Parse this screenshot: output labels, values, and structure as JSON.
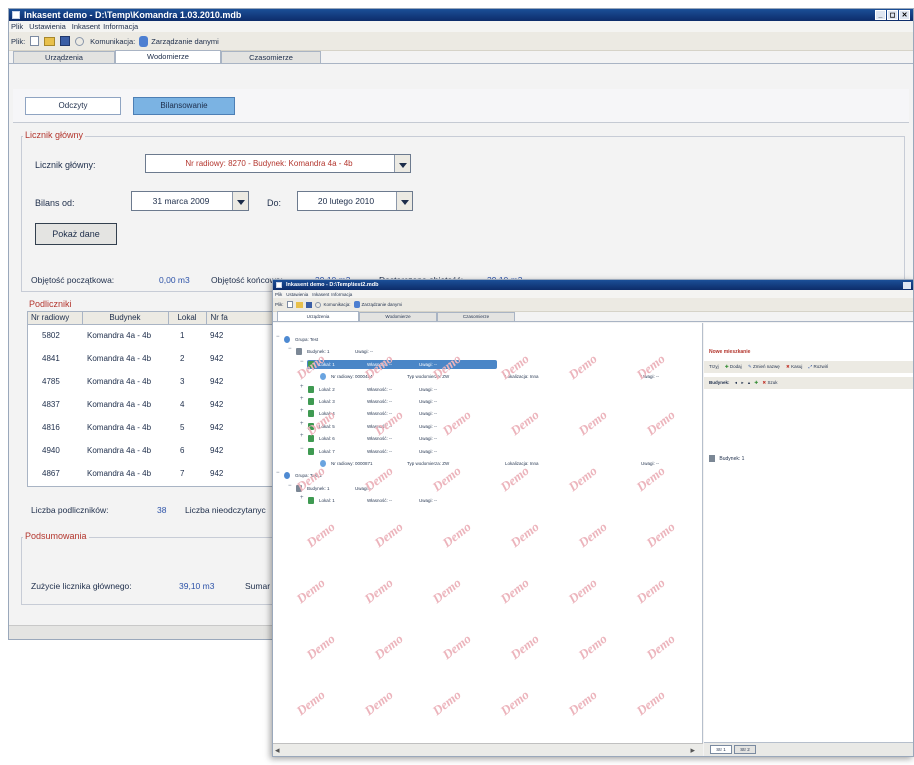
{
  "back_window": {
    "title": "Inkasent demo - D:\\Temp\\Komandra 1.03.2010.mdb",
    "title_buttons": {
      "minimize": "_",
      "maximize": "◻",
      "close": "✕"
    },
    "menu": [
      "Plik",
      "Ustawienia",
      "Inkasent",
      "Informacja"
    ],
    "toolbar": {
      "plik_label": "Plik:",
      "komunikacja_label": "Komunikacja:",
      "zarzadzanie_label": "Zarządzanie danymi"
    },
    "tabs": [
      "Urządzenia",
      "Wodomierze",
      "Czasomierze"
    ],
    "subtabs": [
      "Odczyty",
      "Bilansowanie"
    ],
    "licznik": {
      "group_title": "Licznik główny",
      "main_label": "Licznik główny:",
      "main_value": "Nr radiowy: 8270 - Budynek: Komandra 4a - 4b",
      "bilans_label": "Bilans od:",
      "date_from": "31 marca 2009",
      "date_to_label": "Do:",
      "date_to": "20 lutego 2010",
      "show_button": "Pokaż dane",
      "start_vol_label": "Objętość początkowa:",
      "start_vol_value": "0,00 m3",
      "end_vol_label": "Objętość końcowa:",
      "end_vol_value": "39,10 m3",
      "delivered_label": "Dostarczona objętość:",
      "delivered_value": "39,10 m3"
    },
    "podliczniki": {
      "group_title": "Podliczniki",
      "headers": [
        "Nr radiowy",
        "Budynek",
        "Lokal",
        "Nr fa"
      ],
      "rows": [
        [
          "5802",
          "Komandra 4a - 4b",
          "1",
          "942"
        ],
        [
          "4841",
          "Komandra 4a - 4b",
          "2",
          "942"
        ],
        [
          "4785",
          "Komandra 4a - 4b",
          "3",
          "942"
        ],
        [
          "4837",
          "Komandra 4a - 4b",
          "4",
          "942"
        ],
        [
          "4816",
          "Komandra 4a - 4b",
          "5",
          "942"
        ],
        [
          "4940",
          "Komandra 4a - 4b",
          "6",
          "942"
        ],
        [
          "4867",
          "Komandra 4a - 4b",
          "7",
          "942"
        ]
      ],
      "count_label": "Liczba podliczników:",
      "count_value": "38",
      "unread_label": "Liczba nieodczytanyc"
    },
    "summary": {
      "group_title": "Podsumowania",
      "usage_label": "Zużycie licznika głównego:",
      "usage_value": "39,10 m3",
      "sum_label": "Sumar"
    }
  },
  "front_window": {
    "title": "Inkasent demo - D:\\Temp\\test2.mdb",
    "menu": [
      "Plik",
      "Ustawienia",
      "Inkasent",
      "Informacja"
    ],
    "toolbar": {
      "plik_label": "Plik:",
      "komunikacja_label": "Komunikacja:",
      "zarzadzanie_label": "Zarządzanie danymi"
    },
    "tabs": [
      "Urządzenia",
      "Wodomierze",
      "Czasomierze"
    ],
    "tree": [
      {
        "level": 0,
        "exp": "−",
        "icon": "group",
        "cols": [
          "Grupa: Test"
        ]
      },
      {
        "level": 1,
        "exp": "−",
        "icon": "building",
        "cols": [
          "Budynek: 1",
          "Uwagi: --"
        ]
      },
      {
        "level": 2,
        "exp": "−",
        "icon": "apartment",
        "cols": [
          "Lokal: 1",
          "Własność: --",
          "Uwagi: --"
        ],
        "selected": true
      },
      {
        "level": 3,
        "exp": "",
        "icon": "meter",
        "cols": [
          "Nr radiowy: 0000484",
          "Typ wodomierza: ZW",
          "Lokalizacja: Inna",
          "Uwagi: --"
        ]
      },
      {
        "level": 2,
        "exp": "+",
        "icon": "apartment",
        "cols": [
          "Lokal: 2",
          "Własność: --",
          "Uwagi: --"
        ]
      },
      {
        "level": 2,
        "exp": "+",
        "icon": "apartment",
        "cols": [
          "Lokal: 3",
          "Własność: --",
          "Uwagi: --"
        ]
      },
      {
        "level": 2,
        "exp": "+",
        "icon": "apartment",
        "cols": [
          "Lokal: 4",
          "Własność: --",
          "Uwagi: --"
        ]
      },
      {
        "level": 2,
        "exp": "+",
        "icon": "apartment",
        "cols": [
          "Lokal: 5",
          "Własność: --",
          "Uwagi: --"
        ]
      },
      {
        "level": 2,
        "exp": "+",
        "icon": "apartment",
        "cols": [
          "Lokal: 6",
          "Własność: --",
          "Uwagi: --"
        ]
      },
      {
        "level": 2,
        "exp": "−",
        "icon": "apartment",
        "cols": [
          "Lokal: 7",
          "Własność: --",
          "Uwagi: --"
        ]
      },
      {
        "level": 3,
        "exp": "",
        "icon": "meter",
        "cols": [
          "Nr radiowy: 0000871",
          "Typ wodomierza: ZW",
          "Lokalizacja: Inna",
          "Uwagi: --"
        ]
      },
      {
        "level": 0,
        "exp": "−",
        "icon": "group",
        "cols": [
          "Grupa: Test 2"
        ]
      },
      {
        "level": 1,
        "exp": "−",
        "icon": "building",
        "cols": [
          "Budynek: 1",
          "Uwagi: --"
        ]
      },
      {
        "level": 2,
        "exp": "+",
        "icon": "apartment",
        "cols": [
          "Lokal: 1",
          "Własność: --",
          "Uwagi: --"
        ]
      }
    ],
    "watermark": "Demo",
    "right_panel": {
      "title": "Nowe mieszkanie",
      "toolbar1": [
        "Trzyj",
        "Dodaj",
        "Zmień nazwę",
        "Kasuj",
        "Rozwiń"
      ],
      "toolbar2": [
        "Budynek:",
        "Szuk"
      ],
      "list_item": "Budynek: 1",
      "tabs": [
        "Str 1",
        "Str 2"
      ]
    },
    "scrollbar": {
      "left": "◂",
      "right": "▸"
    }
  },
  "colors": {
    "title_bar": "#0d2c6a",
    "accent_button": "#7bb3e3",
    "selection": "#4a86c7",
    "group_title": "#b3362e",
    "value_text": "#2c52a8"
  }
}
